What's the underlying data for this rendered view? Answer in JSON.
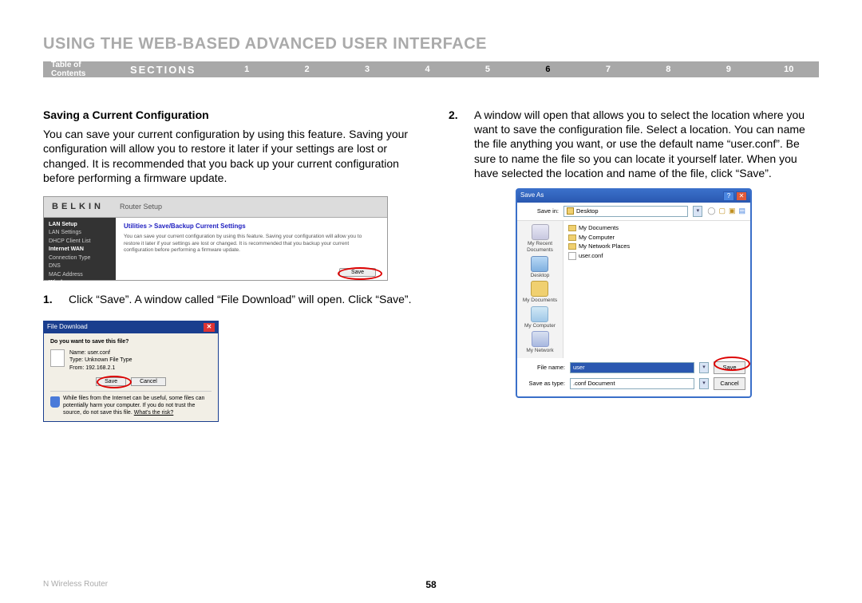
{
  "title": "USING THE WEB-BASED ADVANCED USER INTERFACE",
  "nav": {
    "toc": "Table of Contents",
    "sections_label": "SECTIONS",
    "items": [
      "1",
      "2",
      "3",
      "4",
      "5",
      "6",
      "7",
      "8",
      "9",
      "10"
    ],
    "active": "6"
  },
  "left": {
    "subhead": "Saving a Current Configuration",
    "para": "You can save your current configuration by using this feature. Saving your configuration will allow you to restore it later if your settings are lost or changed. It is recommended that you back up your current configuration before performing a firmware update.",
    "step1_num": "1.",
    "step1_text": "Click “Save”. A window called “File Download” will open. Click “Save”."
  },
  "router": {
    "logo": "BELKIN",
    "sub": "Router Setup",
    "nav_items": [
      {
        "text": "LAN Setup",
        "bold": true
      },
      {
        "text": "LAN Settings",
        "bold": false
      },
      {
        "text": "DHCP Client List",
        "bold": false
      },
      {
        "text": "Internet WAN",
        "bold": true
      },
      {
        "text": "Connection Type",
        "bold": false
      },
      {
        "text": "DNS",
        "bold": false
      },
      {
        "text": "MAC Address",
        "bold": false
      },
      {
        "text": "Wireless",
        "bold": true
      }
    ],
    "crumb": "Utilities > Save/Backup Current Settings",
    "body": "You can save your current configuration by using this feature. Saving your configuration will allow you to restore it later if your settings are lost or changed. It is recommended that you backup your current configuration before performing a firmware update.",
    "save_btn": "Save"
  },
  "download": {
    "title": "File Download",
    "question": "Do you want to save this file?",
    "name_lbl": "Name:",
    "name_val": "user.conf",
    "type_lbl": "Type:",
    "type_val": "Unknown File Type",
    "from_lbl": "From:",
    "from_val": "192.168.2.1",
    "save_btn": "Save",
    "cancel_btn": "Cancel",
    "warn": "While files from the Internet can be useful, some files can potentially harm your computer. If you do not trust the source, do not save this file.",
    "warn_link": "What's the risk?"
  },
  "right": {
    "step2_num": "2.",
    "step2_text": "A window will open that allows you to select the location where you want to save the configuration file. Select a location. You can name the file anything you want, or use the default name “user.conf”. Be sure to name the file so you can locate it yourself later. When you have selected the location and name of the file, click “Save”."
  },
  "saveas": {
    "title": "Save As",
    "savein_lbl": "Save in:",
    "savein_val": "Desktop",
    "side": [
      "My Recent Documents",
      "Desktop",
      "My Documents",
      "My Computer",
      "My Network"
    ],
    "list": [
      "My Documents",
      "My Computer",
      "My Network Places",
      "user.conf"
    ],
    "filename_lbl": "File name:",
    "filename_val": "user",
    "savetype_lbl": "Save as type:",
    "savetype_val": ".conf Document",
    "save_btn": "Save",
    "cancel_btn": "Cancel"
  },
  "footer": {
    "model": "N Wireless Router",
    "page": "58"
  }
}
